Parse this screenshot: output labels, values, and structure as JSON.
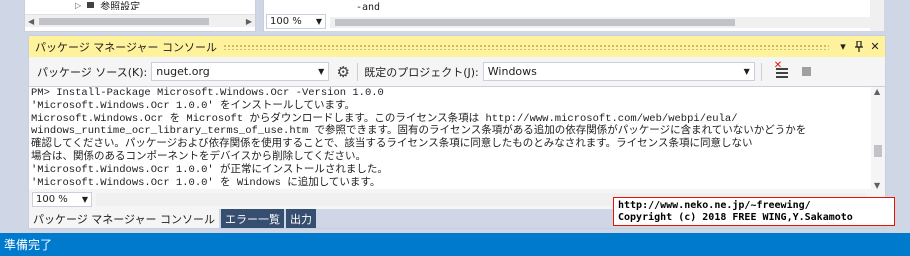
{
  "top_left_pane": {
    "tree_item_label": "参照設定"
  },
  "top_right_pane": {
    "code_fragment": "-and",
    "zoom": "100 %"
  },
  "pmc": {
    "title": "パッケージ マネージャー コンソール",
    "title_buttons": {
      "dropdown": "▾",
      "pin": "⊓",
      "close": "✕"
    },
    "toolbar": {
      "source_label": "パッケージ ソース(K):",
      "source_value": "nuget.org",
      "project_label": "既定のプロジェクト(J):",
      "project_value": "Windows"
    },
    "console_lines": [
      "PM> Install-Package Microsoft.Windows.Ocr -Version 1.0.0",
      "'Microsoft.Windows.Ocr 1.0.0' をインストールしています。",
      "Microsoft.Windows.Ocr を Microsoft からダウンロードします。このライセンス条項は http://www.microsoft.com/web/webpi/eula/",
      "windows_runtime_ocr_library_terms_of_use.htm で参照できます。固有のライセンス条項がある追加の依存関係がパッケージに含まれていないかどうかを",
      "確認してください。パッケージおよび依存関係を使用することで、該当するライセンス条項に同意したものとみなされます。ライセンス条項に同意しない",
      "場合は、関係のあるコンポーネントをデバイスから削除してください。",
      "'Microsoft.Windows.Ocr 1.0.0' が正常にインストールされました。",
      "'Microsoft.Windows.Ocr 1.0.0' を Windows に追加しています。"
    ],
    "zoom": "100 %",
    "tabs": [
      {
        "label": "パッケージ マネージャー コンソール",
        "active": true
      },
      {
        "label": "エラー一覧",
        "active": false
      },
      {
        "label": "出力",
        "active": false
      }
    ]
  },
  "credit": {
    "line1": "http://www.neko.ne.jp/~freewing/",
    "line2": "Copyright (c) 2018 FREE WING,Y.Sakamoto"
  },
  "status_bar": {
    "text": "準備完了"
  },
  "colors": {
    "accent": "#007ACC",
    "title_highlight": "#FFF29D",
    "tab_inactive": "#364E6F",
    "background": "#CFD6E5"
  }
}
